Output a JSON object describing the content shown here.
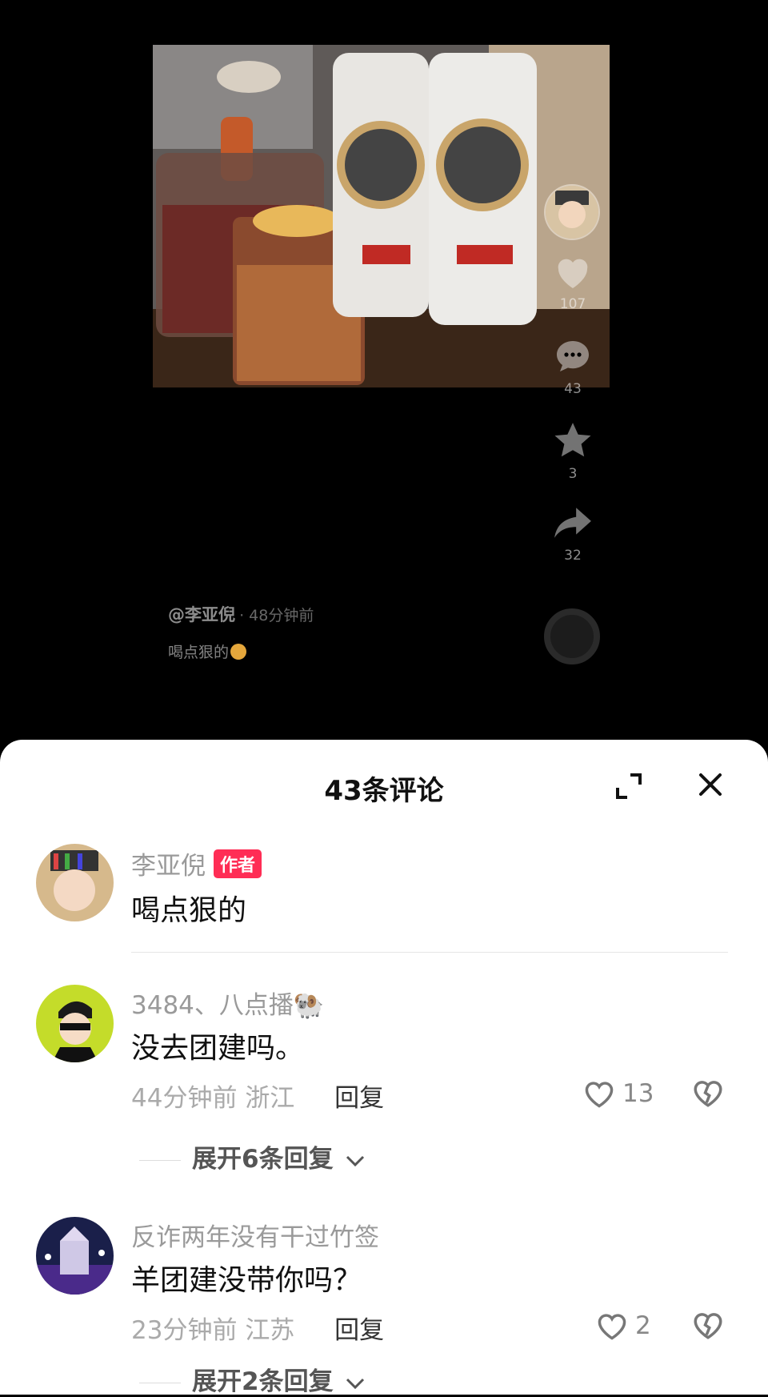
{
  "post": {
    "rail": {
      "likes": "107",
      "comments": "43",
      "favorites": "3",
      "shares": "32"
    },
    "author": "@李亚倪",
    "time": "· 48分钟前",
    "caption": "喝点狠的"
  },
  "comments_sheet": {
    "title": "43条评论",
    "comments": [
      {
        "name": "李亚倪",
        "badge": "作者",
        "text": "喝点狠的"
      },
      {
        "name": "3484、八点播🐏",
        "text": "没去团建吗。",
        "time": "44分钟前",
        "location": "浙江",
        "reply": "回复",
        "likes": "13",
        "expand": "展开6条回复"
      },
      {
        "name": "反诈两年没有干过竹签",
        "text": "羊团建没带你吗？",
        "time": "23分钟前",
        "location": "江苏",
        "reply": "回复",
        "likes": "2",
        "expand": "展开2条回复"
      }
    ]
  },
  "colors": {
    "badge": "#ff2d55",
    "sheet_bg": "#ffffff",
    "video_bg": "#000000"
  }
}
